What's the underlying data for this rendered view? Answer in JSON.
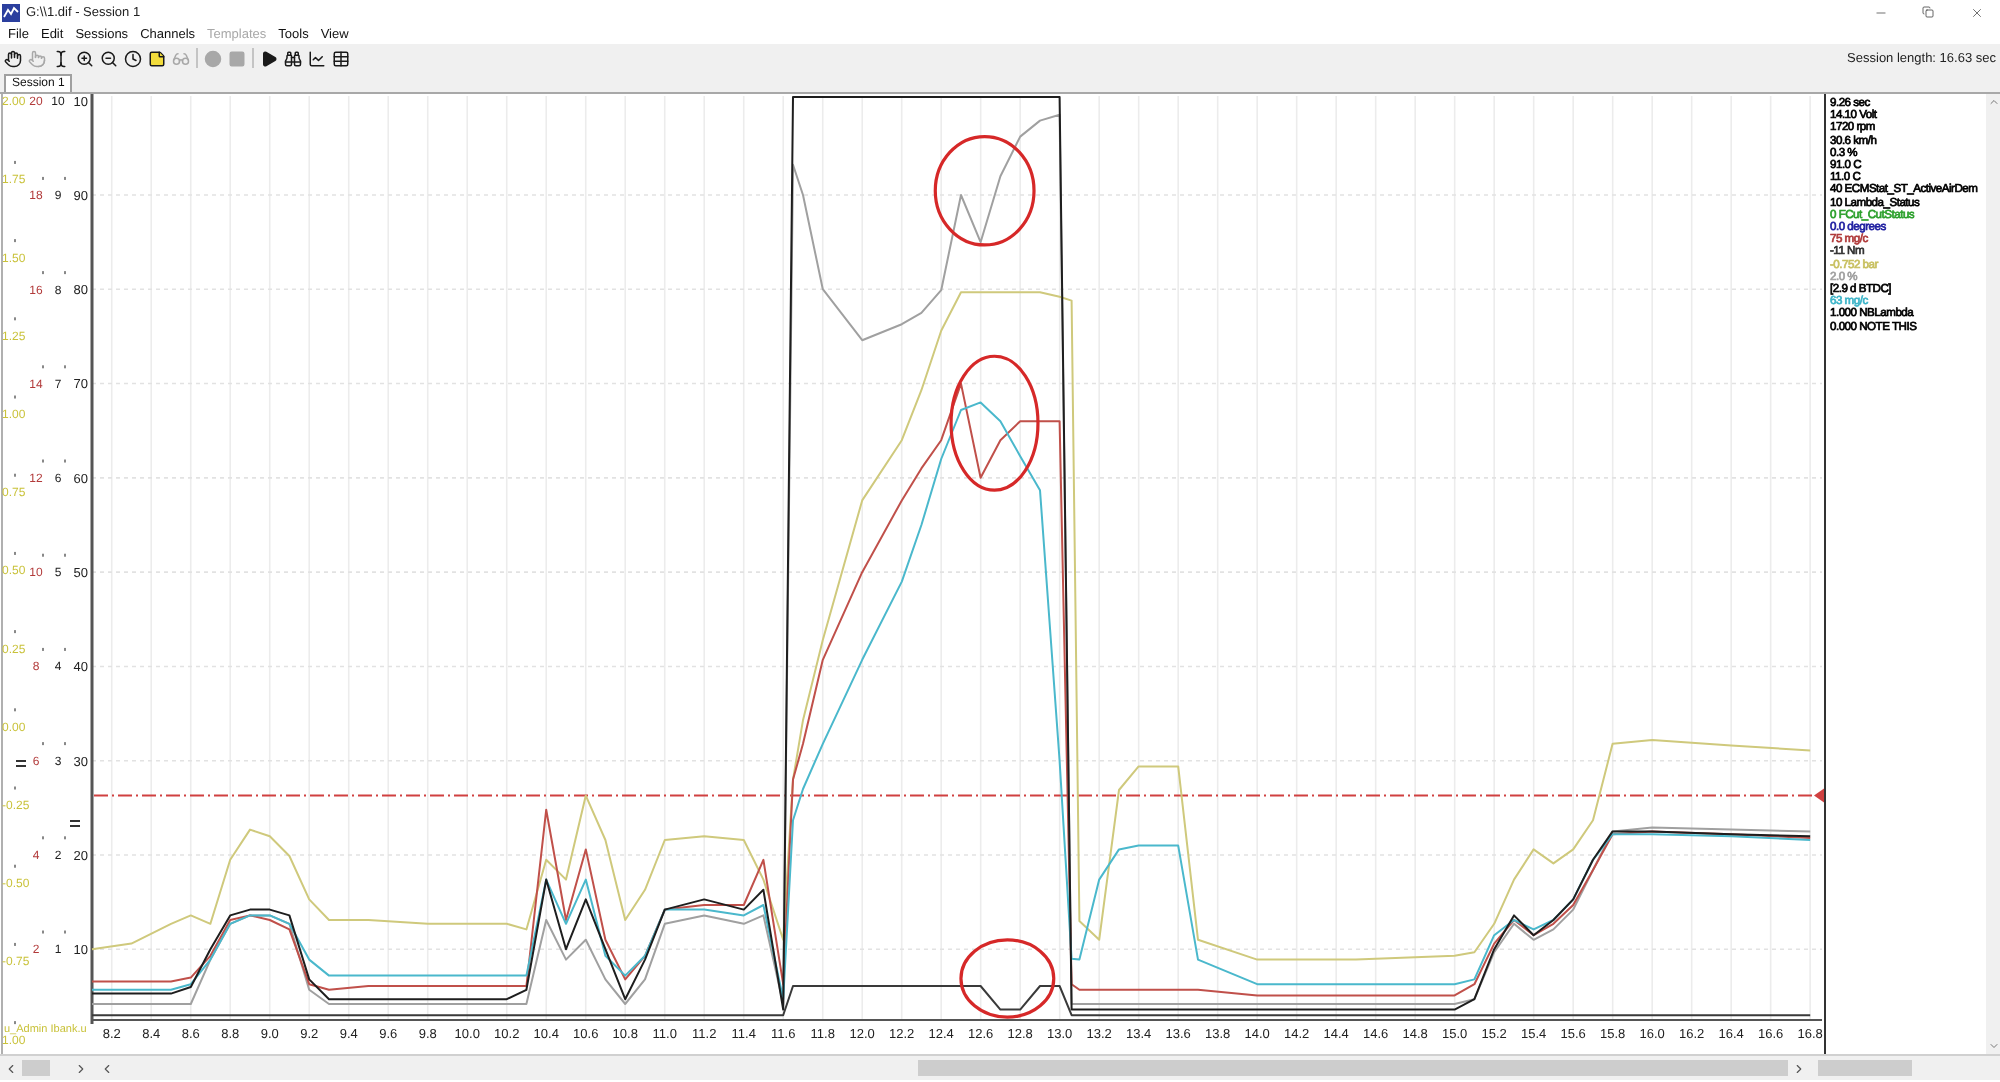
{
  "window": {
    "title": "G:\\\\1.dif - Session 1"
  },
  "menu": [
    {
      "label": "File",
      "disabled": false
    },
    {
      "label": "Edit",
      "disabled": false
    },
    {
      "label": "Sessions",
      "disabled": false
    },
    {
      "label": "Channels",
      "disabled": false
    },
    {
      "label": "Templates",
      "disabled": true
    },
    {
      "label": "Tools",
      "disabled": false
    },
    {
      "label": "View",
      "disabled": false
    }
  ],
  "toolbar": [
    [
      {
        "disabled": false
      },
      {
        "disabled": true
      },
      {
        "disabled": false
      },
      {
        "disabled": false
      },
      {
        "disabled": false
      },
      {
        "disabled": false
      },
      {
        "disabled": false
      },
      {
        "disabled": true
      }
    ],
    [
      {
        "disabled": true
      },
      {
        "disabled": true
      }
    ],
    [
      {
        "disabled": false
      },
      {
        "disabled": false
      },
      {
        "disabled": false
      },
      {
        "disabled": false
      }
    ]
  ],
  "session_length": "Session length: 16.63 sec",
  "tabs": [
    {
      "label": "Session 1",
      "selected": true
    }
  ],
  "plot": {
    "left_axes": [
      {
        "color": "#c9c23a",
        "title": "u_Admin Ibank.u",
        "labels": [
          "2.00",
          "1.75",
          "1.50",
          "1.25",
          "1.00",
          "0.75",
          "0.50",
          "0.25",
          "0.00",
          "-0.25",
          "-0.50",
          "-0.75",
          "1.00"
        ]
      },
      {
        "color": "#b23a3a",
        "labels": [
          "20",
          "18",
          "16",
          "14",
          "12",
          "10",
          "8",
          "6",
          "4",
          "2"
        ]
      },
      {
        "color": "#202020",
        "labels": [
          "10",
          "9",
          "8",
          "7",
          "6",
          "5",
          "4",
          "3",
          "2",
          "1"
        ]
      }
    ],
    "main_axis_top_label": "10",
    "chart_data": {
      "type": "line",
      "grid": true,
      "xlim": [
        8.1,
        16.86
      ],
      "ylim": [
        2.5,
        100.5
      ],
      "xticks": [
        8.2,
        8.4,
        8.6,
        8.8,
        {
          "value": 9,
          "label": "9.0"
        },
        9.2,
        9.4,
        9.6,
        9.8,
        {
          "value": 10,
          "label": "10.0"
        },
        10.2,
        10.4,
        10.6,
        10.8,
        {
          "value": 11,
          "label": "11.0"
        },
        11.2,
        11.4,
        11.6,
        11.8,
        {
          "value": 12,
          "label": "12.0"
        },
        12.2,
        12.4,
        12.6,
        12.8,
        {
          "value": 13,
          "label": "13.0"
        },
        13.2,
        13.4,
        13.6,
        13.8,
        {
          "value": 14,
          "label": "14.0"
        },
        14.2,
        14.4,
        14.6,
        14.8,
        {
          "value": 15,
          "label": "15.0"
        },
        15.2,
        15.4,
        15.6,
        15.8,
        {
          "value": 16,
          "label": "16.0"
        },
        16.2,
        16.4,
        16.6,
        16.8
      ],
      "yticks": [
        90,
        80,
        70,
        60,
        50,
        40,
        30,
        20,
        10
      ],
      "x": [
        8.1,
        8.3,
        8.5,
        8.6,
        8.7,
        8.8,
        8.9,
        9.0,
        9.1,
        9.2,
        9.3,
        9.5,
        9.8,
        10.0,
        10.2,
        10.3,
        10.4,
        10.5,
        10.6,
        10.7,
        10.8,
        10.9,
        11.0,
        11.2,
        11.4,
        11.5,
        11.6,
        11.65,
        11.7,
        11.8,
        12.0,
        12.2,
        12.3,
        12.4,
        12.5,
        12.6,
        12.7,
        12.8,
        12.9,
        13.0,
        13.06,
        13.1,
        13.2,
        13.3,
        13.4,
        13.5,
        13.6,
        13.7,
        14.0,
        14.5,
        15.0,
        15.1,
        15.2,
        15.3,
        15.4,
        15.5,
        15.6,
        15.7,
        15.8,
        16.0,
        16.4,
        16.8
      ],
      "series": [
        {
          "color": "#3a3a3a",
          "values": [
            3,
            3,
            3,
            3,
            3,
            3,
            3,
            3,
            3,
            3,
            3,
            3,
            3,
            3,
            3,
            3,
            3,
            3,
            3,
            3,
            3,
            3,
            3,
            3,
            3,
            3,
            3,
            6.1,
            6.1,
            6.1,
            6.1,
            6.1,
            6.1,
            6.1,
            6.1,
            6.1,
            3.6,
            3.6,
            6.1,
            6.1,
            3,
            3,
            3,
            3,
            3,
            3,
            3,
            3,
            3,
            3,
            3,
            3,
            3,
            3,
            3,
            3,
            3,
            3,
            3,
            3,
            3,
            3
          ]
        },
        {
          "color": "#a0a0a0",
          "values": [
            4.2,
            4.2,
            4.2,
            4.2,
            8.9,
            12.7,
            13.6,
            13.6,
            12.7,
            5.7,
            4.2,
            4.2,
            4.2,
            4.2,
            4.2,
            4.2,
            13.1,
            8.9,
            11,
            6.8,
            4.2,
            6.8,
            12.7,
            13.6,
            12.7,
            13.6,
            4.2,
            93.2,
            90,
            80,
            74.6,
            76.3,
            77.5,
            79.9,
            90,
            85,
            92,
            96.2,
            97.9,
            98.5,
            4.2,
            4.2,
            4.2,
            4.2,
            4.2,
            4.2,
            4.2,
            4.2,
            4.2,
            4.2,
            4.2,
            4.7,
            9.7,
            12.7,
            11,
            12.1,
            14.2,
            18.4,
            22.5,
            22.9,
            22.7,
            22.5
          ]
        },
        {
          "color": "#cfc97c",
          "values": [
            10,
            10.6,
            12.7,
            13.6,
            12.7,
            19.5,
            22.7,
            22,
            19.9,
            15.3,
            13.1,
            13.1,
            12.7,
            12.7,
            12.7,
            12.1,
            19.5,
            17.4,
            26.3,
            21.6,
            13.1,
            16.3,
            21.6,
            22,
            21.6,
            17.4,
            11,
            28,
            34.3,
            42.8,
            57.6,
            64,
            69.3,
            75.6,
            79.7,
            79.7,
            79.7,
            79.7,
            79.7,
            79.2,
            78.8,
            13,
            11,
            26.9,
            29.4,
            29.4,
            29.4,
            11,
            8.9,
            8.9,
            9.3,
            9.7,
            12.7,
            17.4,
            20.6,
            19.1,
            20.6,
            23.7,
            31.8,
            32.2,
            31.6,
            31.1
          ]
        },
        {
          "color": "#c0504a",
          "values": [
            6.6,
            6.6,
            6.6,
            7,
            9.3,
            13.1,
            13.6,
            13.1,
            12.1,
            6.3,
            5.7,
            6.1,
            6.1,
            6.1,
            6.1,
            6.1,
            24.8,
            13.1,
            20.6,
            11,
            6.8,
            9.3,
            14.2,
            14.7,
            14.7,
            19.5,
            6.3,
            28,
            31.8,
            40.7,
            50,
            57.6,
            61,
            64,
            70,
            60,
            64,
            66,
            66,
            66,
            6.3,
            5.7,
            5.7,
            5.7,
            5.7,
            5.7,
            5.7,
            5.7,
            5.1,
            5.1,
            5.1,
            6.3,
            10.6,
            13.1,
            11.5,
            12.7,
            14.7,
            18.4,
            22.2,
            22.5,
            22.2,
            21.8
          ]
        },
        {
          "color": "#4ab8cc",
          "values": [
            5.7,
            5.7,
            5.7,
            6.3,
            8.9,
            12.7,
            13.6,
            13.6,
            12.7,
            8.9,
            7.2,
            7.2,
            7.2,
            7.2,
            7.2,
            7.2,
            17.4,
            12.7,
            17.4,
            9.3,
            7.2,
            9.3,
            14.2,
            14.2,
            13.6,
            14.7,
            4.7,
            23.7,
            27,
            31.8,
            40.7,
            49,
            55,
            62,
            67.2,
            68,
            66,
            62.3,
            58.7,
            30,
            9,
            8.9,
            17.4,
            20.6,
            21,
            21,
            21,
            8.9,
            6.3,
            6.3,
            6.3,
            6.8,
            11.5,
            13.1,
            12.1,
            13.1,
            15.3,
            19.5,
            22.2,
            22.2,
            22,
            21.6
          ]
        },
        {
          "color": "#1e1e1e",
          "values": [
            5.3,
            5.3,
            5.3,
            6,
            10,
            13.6,
            14.2,
            14.2,
            13.6,
            6.8,
            4.7,
            4.7,
            4.7,
            4.7,
            4.7,
            5.7,
            17.4,
            10,
            15.3,
            10,
            4.7,
            8.9,
            14.2,
            15.3,
            14.2,
            16.3,
            3.6,
            100.4,
            100.4,
            100.4,
            100.4,
            100.4,
            100.4,
            100.4,
            100.4,
            100.4,
            100.4,
            100.4,
            100.4,
            100.4,
            3.6,
            3.6,
            3.6,
            3.6,
            3.6,
            3.6,
            3.6,
            3.6,
            3.6,
            3.6,
            3.6,
            4.7,
            10,
            13.6,
            11.5,
            13.1,
            15.3,
            19.5,
            22.5,
            22.5,
            22.2,
            22
          ]
        }
      ],
      "ref_lines": [
        {
          "axis": "y",
          "value": 26.3
        }
      ]
    }
  },
  "channel_values": [
    {
      "text": "9.26 sec",
      "color": "#000000"
    },
    {
      "text": "14.10 Volt",
      "color": "#000000"
    },
    {
      "text": "1720 rpm",
      "color": "#000000"
    },
    {
      "text": "30.6 km/h",
      "color": "#000000"
    },
    {
      "text": "0.3 %",
      "color": "#000000"
    },
    {
      "text": "91.0 C",
      "color": "#000000"
    },
    {
      "text": "11.0 C",
      "color": "#000000"
    },
    {
      "text": "40 ECMStat_ST_ActiveAirDem",
      "color": "#000000"
    },
    {
      "text": "10 Lambda_Status",
      "color": "#000000"
    },
    {
      "text": "0 FCut_CutStatus",
      "color": "#2ca02c"
    },
    {
      "text": "0.0 degrees",
      "color": "#1f1fa0"
    },
    {
      "text": "75 mg/c",
      "color": "#b03a3a"
    },
    {
      "text": "-11 Nm",
      "color": "#303030"
    },
    {
      "text": "-0.752 bar",
      "color": "#c8c060"
    },
    {
      "text": "2.0 %",
      "color": "#a0a0a0"
    },
    {
      "text": "[2.9 d BTDC]",
      "color": "#000000"
    },
    {
      "text": "63 mg/c",
      "color": "#3cb4c8"
    },
    {
      "text": "1.000 NBLambda",
      "color": "#000000"
    },
    {
      "text": "0.000 NOTE THIS",
      "color": "#000000"
    }
  ]
}
